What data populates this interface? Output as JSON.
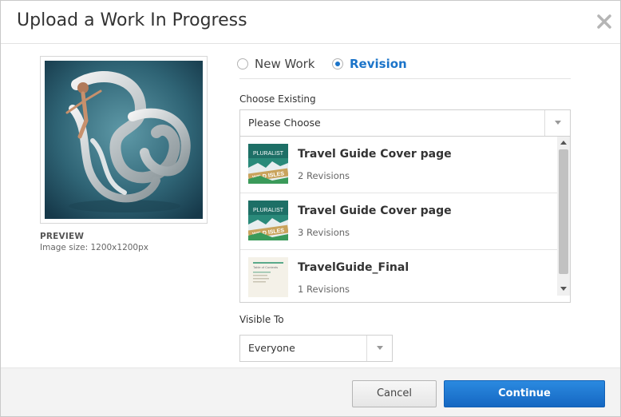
{
  "dialog": {
    "title": "Upload a Work In Progress",
    "close_icon": "close-icon"
  },
  "preview": {
    "label": "PREVIEW",
    "size_text": "Image size: 1200x1200px"
  },
  "mode": {
    "options": [
      {
        "label": "New Work",
        "checked": false
      },
      {
        "label": "Revision",
        "checked": true
      }
    ]
  },
  "choose_existing": {
    "label": "Choose Existing",
    "selected": "Please Choose",
    "items": [
      {
        "title": "Travel Guide Cover page",
        "revisions": "2 Revisions",
        "thumb_text_top": "PLURALIST",
        "thumb_text": "WILD ISLES"
      },
      {
        "title": "Travel Guide Cover page",
        "revisions": "3 Revisions",
        "thumb_text_top": "PLURALIST",
        "thumb_text": "WILD ISLES"
      },
      {
        "title": "TravelGuide_Final",
        "revisions": "1 Revisions",
        "thumb_text_top": "Table of Contents"
      }
    ]
  },
  "visibility": {
    "label": "Visible To",
    "selected": "Everyone"
  },
  "footer": {
    "cancel_label": "Cancel",
    "continue_label": "Continue"
  },
  "colors": {
    "accent": "#1b74c9",
    "continue_button": "#1a6fcc"
  }
}
